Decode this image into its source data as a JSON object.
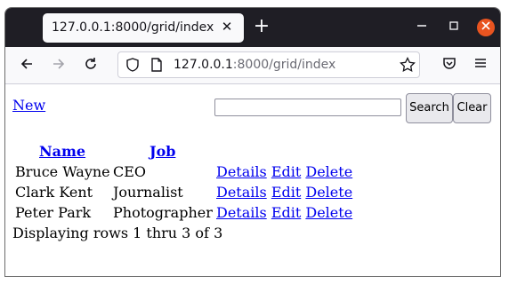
{
  "browser": {
    "tab_title": "127.0.0.1:8000/grid/index",
    "tab_close": "✕",
    "new_tab": "+",
    "url_host": "127.0.0.1",
    "url_path": ":8000/grid/index",
    "accent_close": "#e95420"
  },
  "page": {
    "new_label": " New",
    "search_value": "",
    "search_button": "Search",
    "clear_button": "Clear",
    "headers": {
      "name": "Name",
      "job": "Job"
    },
    "rows": [
      {
        "name": "Bruce Wayne",
        "job": "CEO",
        "details": " Details",
        "edit": "Edit",
        "delete": "Delete"
      },
      {
        "name": "Clark Kent",
        "job": "Journalist",
        "details": " Details",
        "edit": "Edit",
        "delete": "Delete"
      },
      {
        "name": "Peter Park",
        "job": "Photographer",
        "details": " Details",
        "edit": "Edit",
        "delete": "Delete"
      }
    ],
    "footer": "Displaying rows 1 thru 3 of 3"
  }
}
